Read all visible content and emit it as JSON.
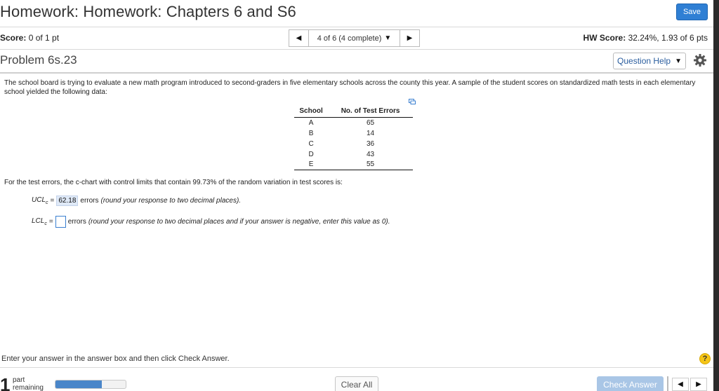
{
  "header": {
    "title": "Homework: Homework: Chapters 6 and S6",
    "save_label": "Save"
  },
  "status_bar": {
    "score_label": "Score:",
    "score_value": "0 of 1 pt",
    "nav_text": "4 of 6 (4 complete)",
    "hw_score_label": "HW Score:",
    "hw_score_value": "32.24%, 1.93 of 6 pts"
  },
  "problem_bar": {
    "problem_title": "Problem 6s.23",
    "question_help_label": "Question Help"
  },
  "problem": {
    "intro": "The school board is trying to evaluate a new math program introduced to second-graders in five elementary schools across the county this year. A sample of the student scores on standardized math tests in each elementary school yielded the following data:",
    "table": {
      "headers": [
        "School",
        "No. of Test Errors"
      ],
      "rows": [
        [
          "A",
          "65"
        ],
        [
          "B",
          "14"
        ],
        [
          "C",
          "36"
        ],
        [
          "D",
          "43"
        ],
        [
          "E",
          "55"
        ]
      ]
    },
    "question": "For the test errors, the c-chart with control limits that contain 99.73% of the random variation in test scores is:",
    "ucl": {
      "label_main": "UCL",
      "label_sub": "c",
      "equals": "=",
      "value": "62.18",
      "unit": "errors",
      "hint": "(round your response to two decimal places)."
    },
    "lcl": {
      "label_main": "LCL",
      "label_sub": "c",
      "equals": "=",
      "value": "",
      "unit": "errors",
      "hint": "(round your response to two decimal places and if your answer is negative, enter this value as 0)."
    }
  },
  "footer": {
    "instruction": "Enter your answer in the answer box and then click Check Answer.",
    "help_symbol": "?",
    "parts_count": "1",
    "parts_line1": "part",
    "parts_line2": "remaining",
    "progress": 0.66,
    "clear_all_label": "Clear All",
    "check_answer_label": "Check Answer"
  },
  "colors": {
    "accent": "#2f7fd4",
    "progress_fill": "#4a86c9",
    "check_answer_disabled": "#a9c6e6",
    "help_circle": "#f5c518"
  }
}
